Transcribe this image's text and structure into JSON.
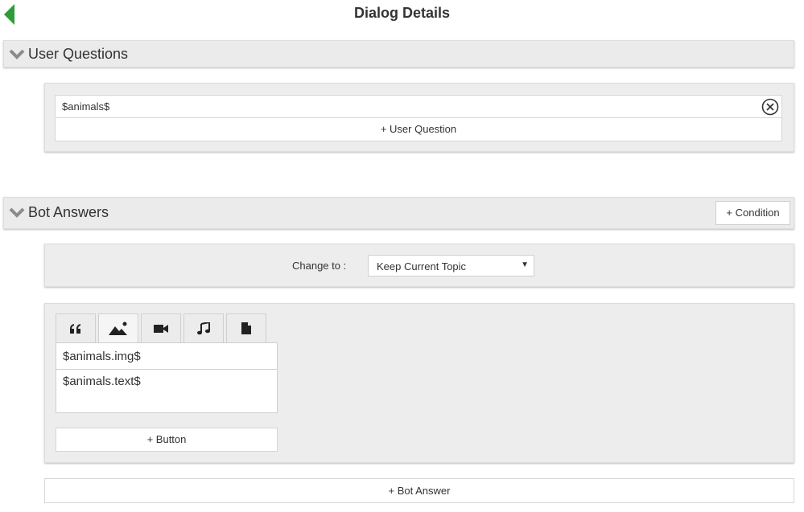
{
  "header": {
    "title": "Dialog Details",
    "back_icon": "back-triangle-icon",
    "accent_color": "#2e9c3a"
  },
  "user_questions": {
    "title": "User Questions",
    "questions": [
      {
        "value": "$animals$"
      }
    ],
    "add_label": "+ User Question"
  },
  "bot_answers": {
    "title": "Bot Answers",
    "condition_label": "+ Condition",
    "change_to_label": "Change to :",
    "topic_selected": "Keep Current Topic",
    "tabs": [
      "quote-icon",
      "image-icon",
      "video-icon",
      "music-icon",
      "file-icon"
    ],
    "active_tab": 1,
    "image_value": "$animals.img$",
    "text_value": "$animals.text$",
    "add_button_label": "+ Button",
    "add_answer_label": "+ Bot Answer"
  }
}
